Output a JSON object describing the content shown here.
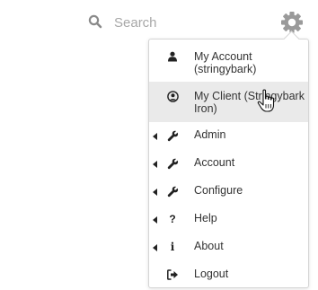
{
  "search": {
    "placeholder": "Search",
    "icon": "search-icon"
  },
  "settings": {
    "icon": "gear-icon"
  },
  "menu": {
    "items": [
      {
        "label_line1": "My Account",
        "label_line2": "(stringybark)",
        "icon": "user-icon",
        "has_submenu": false
      },
      {
        "label_line1": "My Client (Stringybark",
        "label_line2": "Iron)",
        "icon": "user-circle-icon",
        "has_submenu": false,
        "active": true
      },
      {
        "label": "Admin",
        "icon": "wrench-icon",
        "has_submenu": true
      },
      {
        "label": "Account",
        "icon": "wrench-icon",
        "has_submenu": true
      },
      {
        "label": "Configure",
        "icon": "wrench-icon",
        "has_submenu": true
      },
      {
        "label": "Help",
        "icon": "question-icon",
        "has_submenu": true
      },
      {
        "label": "About",
        "icon": "info-icon",
        "has_submenu": true
      },
      {
        "label": "Logout",
        "icon": "sign-out-icon",
        "has_submenu": false
      }
    ]
  },
  "colors": {
    "active_bg": "#eaeaea",
    "border": "#d6d6d6",
    "text": "#333333",
    "placeholder": "#a8a8a8"
  }
}
